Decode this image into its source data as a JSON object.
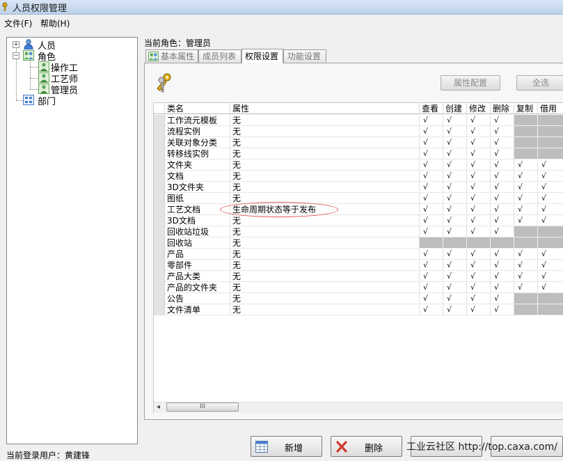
{
  "window": {
    "title": "人员权限管理"
  },
  "menu": [
    {
      "label": "文件(F)"
    },
    {
      "label": "帮助(H)"
    }
  ],
  "tree": {
    "people": "人员",
    "roles": "角色",
    "role_children": [
      "操作工",
      "工艺师",
      "管理员"
    ],
    "department": "部门"
  },
  "current_role": "当前角色：管理员",
  "tabs": [
    {
      "label": "基本属性",
      "active": false
    },
    {
      "label": "成员列表",
      "active": false
    },
    {
      "label": "权限设置",
      "active": true
    },
    {
      "label": "功能设置",
      "active": false
    }
  ],
  "buttons": {
    "attr_config": "属性配置",
    "select_all": "全选"
  },
  "grid": {
    "columns": [
      "类名",
      "属性",
      "查看",
      "创建",
      "修改",
      "删除",
      "复制",
      "借用"
    ],
    "check_mark": "√",
    "rows": [
      {
        "name": "工作流元模板",
        "attr": "无",
        "perm": [
          "y",
          "y",
          "y",
          "y",
          "g",
          "g"
        ]
      },
      {
        "name": "流程实例",
        "attr": "无",
        "perm": [
          "y",
          "y",
          "y",
          "y",
          "g",
          "g"
        ]
      },
      {
        "name": "关联对象分类",
        "attr": "无",
        "perm": [
          "y",
          "y",
          "y",
          "y",
          "g",
          "g"
        ]
      },
      {
        "name": "转移线实例",
        "attr": "无",
        "perm": [
          "y",
          "y",
          "y",
          "y",
          "g",
          "g"
        ]
      },
      {
        "name": "文件夹",
        "attr": "无",
        "perm": [
          "y",
          "y",
          "y",
          "y",
          "y",
          "y"
        ]
      },
      {
        "name": "文档",
        "attr": "无",
        "perm": [
          "y",
          "y",
          "y",
          "y",
          "y",
          "y"
        ]
      },
      {
        "name": "3D文件夹",
        "attr": "无",
        "perm": [
          "y",
          "y",
          "y",
          "y",
          "y",
          "y"
        ]
      },
      {
        "name": "图纸",
        "attr": "无",
        "perm": [
          "y",
          "y",
          "y",
          "y",
          "y",
          "y"
        ]
      },
      {
        "name": "工艺文档",
        "attr": "生命周期状态等于发布",
        "perm": [
          "y",
          "y",
          "y",
          "y",
          "y",
          "y"
        ]
      },
      {
        "name": "3D文档",
        "attr": "无",
        "perm": [
          "y",
          "y",
          "y",
          "y",
          "y",
          "y"
        ]
      },
      {
        "name": "回收站垃圾",
        "attr": "无",
        "perm": [
          "y",
          "y",
          "y",
          "y",
          "g",
          "g"
        ]
      },
      {
        "name": "回收站",
        "attr": "无",
        "perm": [
          "g",
          "g",
          "g",
          "g",
          "g",
          "g"
        ]
      },
      {
        "name": "产品",
        "attr": "无",
        "perm": [
          "y",
          "y",
          "y",
          "y",
          "y",
          "y"
        ]
      },
      {
        "name": "零部件",
        "attr": "无",
        "perm": [
          "y",
          "y",
          "y",
          "y",
          "y",
          "y"
        ]
      },
      {
        "name": "产品大类",
        "attr": "无",
        "perm": [
          "y",
          "y",
          "y",
          "y",
          "y",
          "y"
        ]
      },
      {
        "name": "产品的文件夹",
        "attr": "无",
        "perm": [
          "y",
          "y",
          "y",
          "y",
          "y",
          "y"
        ]
      },
      {
        "name": "公告",
        "attr": "无",
        "perm": [
          "y",
          "y",
          "y",
          "y",
          "g",
          "g"
        ]
      },
      {
        "name": "文件清单",
        "attr": "无",
        "perm": [
          "y",
          "y",
          "y",
          "y",
          "g",
          "g"
        ]
      }
    ]
  },
  "scroll": {
    "left_arrow": "◂",
    "thumb_grip": "III"
  },
  "bottom_buttons": {
    "add": "新增",
    "delete": "删除"
  },
  "status": "当前登录用户：黄建锋",
  "watermark": "工业云社区 http://top.caxa.com/",
  "colors": {
    "gray_cell": "#bdbdbd",
    "annotation": "#e05050"
  }
}
